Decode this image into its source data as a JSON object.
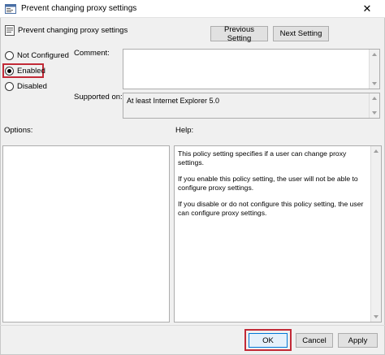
{
  "window": {
    "title": "Prevent changing proxy settings",
    "close_glyph": "✕"
  },
  "header": {
    "policy_title": "Prevent changing proxy settings",
    "previous_setting": "Previous Setting",
    "next_setting": "Next Setting"
  },
  "state": {
    "options": [
      {
        "label": "Not Configured",
        "checked": false
      },
      {
        "label": "Enabled",
        "checked": true
      },
      {
        "label": "Disabled",
        "checked": false
      }
    ]
  },
  "comment": {
    "label": "Comment:",
    "value": ""
  },
  "supported": {
    "label": "Supported on:",
    "value": "At least Internet Explorer 5.0"
  },
  "options_panel": {
    "label": "Options:"
  },
  "help_panel": {
    "label": "Help:",
    "paragraphs": [
      "This policy setting specifies if a user can change proxy settings.",
      "If you enable this policy setting, the user will not be able to configure proxy settings.",
      "If you disable or do not configure this policy setting, the user can configure proxy settings."
    ]
  },
  "footer": {
    "ok": "OK",
    "cancel": "Cancel",
    "apply": "Apply"
  },
  "colors": {
    "highlight": "#c22a37",
    "button_bg": "#e1e1e1",
    "window_bg": "#f0f0f0"
  },
  "icons": [
    "policy-window-icon",
    "close-icon",
    "policy-setting-icon",
    "scroll-up-icon",
    "scroll-down-icon"
  ]
}
